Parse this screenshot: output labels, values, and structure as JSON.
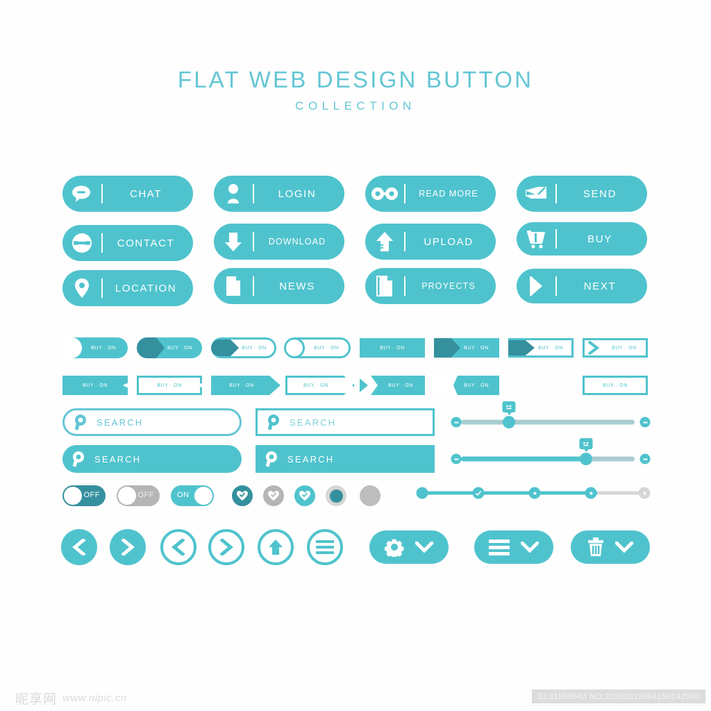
{
  "title": {
    "main": "FLAT WEB DESIGN BUTTON",
    "sub": "COLLECTION"
  },
  "colors": {
    "teal": "#4fc3cd",
    "dark_teal": "#35909e",
    "gray": "#b5b5b5",
    "light_gray": "#d6d6d6",
    "track_gray": "#a9ccd1",
    "white": "#ffffff",
    "background": "#ffffff"
  },
  "icon_buttons": [
    {
      "label": "CHAT",
      "icon": "chat-bubble-icon"
    },
    {
      "label": "LOGIN",
      "icon": "user-icon"
    },
    {
      "label": "READ MORE",
      "icon": "glasses-icon"
    },
    {
      "label": "SEND",
      "icon": "envelope-pencil-icon"
    },
    {
      "label": "CONTACT",
      "icon": "contact-card-icon"
    },
    {
      "label": "DOWNLOAD",
      "icon": "arrow-down-icon"
    },
    {
      "label": "UPLOAD",
      "icon": "arrow-up-icon"
    },
    {
      "label": "BUY",
      "icon": "shopping-cart-icon"
    },
    {
      "label": "LOCATION",
      "icon": "map-pin-icon"
    },
    {
      "label": "NEWS",
      "icon": "document-icon"
    },
    {
      "label": "PROYECTS",
      "icon": "documents-icon"
    },
    {
      "label": "NEXT",
      "icon": "play-triangle-icon"
    }
  ],
  "chips": {
    "label": "BUY · ON",
    "row1": [
      {
        "style": "pill-knob-white-on-teal"
      },
      {
        "style": "pill-arrow-darkteal-on-teal"
      },
      {
        "style": "pill-arrow-darkteal-outline"
      },
      {
        "style": "pill-knob-outline"
      },
      {
        "style": "rect-solid-teal"
      },
      {
        "style": "rect-arrow-darkteal-on-teal"
      },
      {
        "style": "rect-arrow-darkteal-outline"
      },
      {
        "style": "rect-chevron-outline"
      }
    ],
    "row2": [
      {
        "style": "rect-solid-teal-notch"
      },
      {
        "style": "rect-outline-notch"
      },
      {
        "style": "rect-solid-teal-point"
      },
      {
        "style": "rect-outline-point"
      },
      {
        "style": "rect-teal-inner-chevron"
      },
      {
        "style": "rect-outline-inner-notch"
      },
      {
        "style": "rect-teal-inner-white"
      }
    ]
  },
  "search_bars": [
    {
      "placeholder": "SEARCH",
      "style": "rounded-outline",
      "icon": "search-icon"
    },
    {
      "placeholder": "SEARCH",
      "style": "square-outline",
      "icon": "search-icon"
    },
    {
      "placeholder": "SEARCH",
      "style": "rounded-filled",
      "icon": "search-icon"
    },
    {
      "placeholder": "SEARCH",
      "style": "square-filled",
      "icon": "search-icon"
    }
  ],
  "sliders": [
    {
      "name": "slider-unfilled",
      "value_percent": 27,
      "tooltip": "",
      "track": "gray"
    },
    {
      "name": "slider-filled",
      "value_percent": 70,
      "tooltip": "",
      "track": "teal"
    }
  ],
  "stepper": {
    "nodes": 5,
    "completed": 4,
    "icons": [
      "dot",
      "check",
      "dot",
      "dot",
      "dot"
    ]
  },
  "toggles": [
    {
      "label": "OFF",
      "state": "off",
      "color": "dark_teal"
    },
    {
      "label": "OFF",
      "state": "off",
      "color": "gray"
    },
    {
      "label": "ON",
      "state": "on",
      "color": "teal"
    }
  ],
  "check_circles": [
    {
      "icon": "heart-check-icon",
      "color": "dark_teal"
    },
    {
      "icon": "heart-check-icon",
      "color": "gray"
    },
    {
      "icon": "heart-check-icon",
      "color": "teal"
    },
    {
      "icon": "filled-dot-icon",
      "color": "teal-on-gray"
    },
    {
      "icon": "empty-dot-icon",
      "color": "gray"
    }
  ],
  "round_buttons": [
    {
      "icon": "chevron-left-icon",
      "style": "filled"
    },
    {
      "icon": "chevron-right-icon",
      "style": "filled"
    },
    {
      "icon": "chevron-left-icon",
      "style": "outline"
    },
    {
      "icon": "chevron-right-icon",
      "style": "outline"
    },
    {
      "icon": "arrow-up-icon",
      "style": "outline"
    },
    {
      "icon": "list-lines-icon",
      "style": "outline"
    }
  ],
  "dropdown_buttons": [
    {
      "icon": "gear-icon",
      "chevron": "chevron-down-icon"
    },
    {
      "icon": "hamburger-icon",
      "chevron": "chevron-down-icon"
    },
    {
      "icon": "trash-icon",
      "chevron": "chevron-down-icon"
    }
  ],
  "footer": {
    "watermark_cn": "昵享网",
    "watermark_url": "www.nipic.cn",
    "id_text": "ID:31869643 NO:20201013094150142000"
  }
}
